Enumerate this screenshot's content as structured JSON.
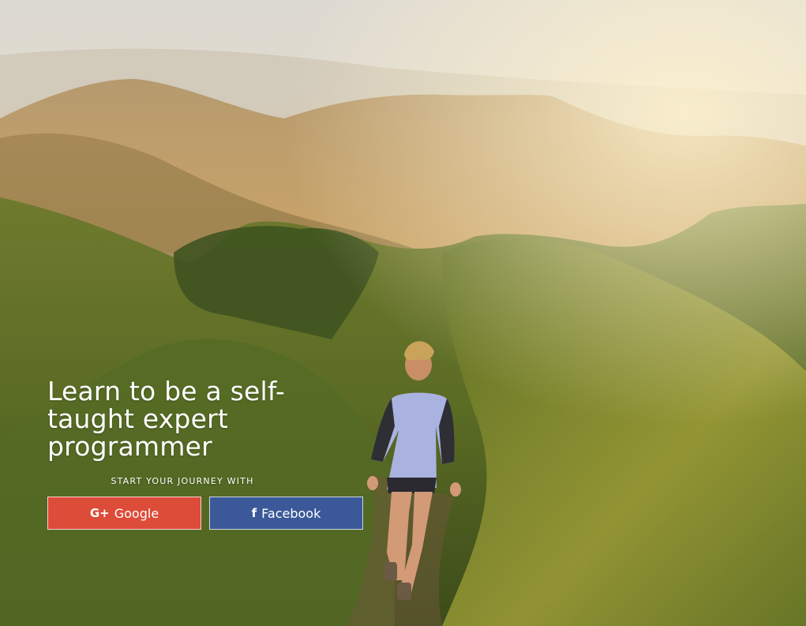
{
  "hero": {
    "headline": "Learn to be a self-taught expert programmer",
    "subheading": "START YOUR JOURNEY WITH"
  },
  "auth": {
    "google": {
      "label": "Google",
      "icon": "google-plus-icon",
      "icon_glyph": "G+",
      "color": "#dd4b39"
    },
    "facebook": {
      "label": "Facebook",
      "icon": "facebook-icon",
      "icon_glyph": "f",
      "color": "#3b5998"
    }
  }
}
